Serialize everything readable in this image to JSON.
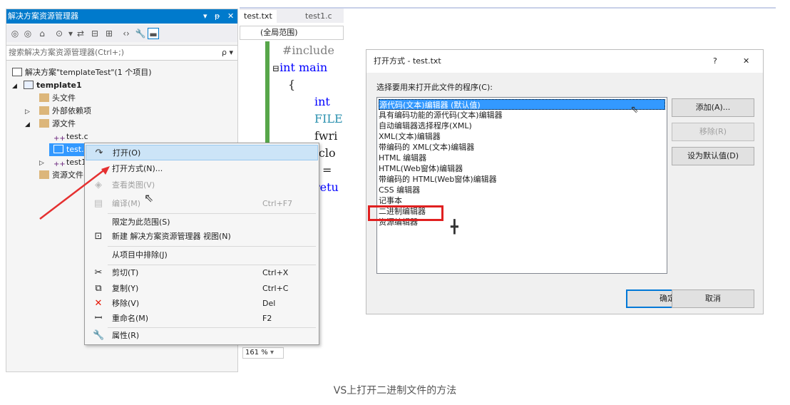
{
  "solution_explorer": {
    "title": "解决方案资源管理器",
    "title_buttons": [
      "▾",
      "ᵽ",
      "✕"
    ],
    "search_placeholder": "搜索解决方案资源管理器(Ctrl+;)",
    "search_icon": "ρ ▾",
    "tree": [
      {
        "label": "解决方案\"templateTest\"(1 个项目)",
        "expander": "",
        "icon": "solution-icon"
      },
      {
        "label": "template1",
        "expander": "◢",
        "icon": "project-icon"
      },
      {
        "label": "头文件",
        "expander": "",
        "icon": "folder-icon"
      },
      {
        "label": "外部依赖项",
        "expander": "▷",
        "icon": "folder-icon"
      },
      {
        "label": "源文件",
        "expander": "◢",
        "icon": "folder-icon"
      },
      {
        "label": "test.c",
        "expander": "",
        "icon": "cpp-file-icon"
      },
      {
        "label": "test.t",
        "expander": "",
        "icon": "text-file-icon"
      },
      {
        "label": "test1",
        "expander": "▷",
        "icon": "cpp-file-icon"
      },
      {
        "label": "资源文件",
        "expander": "",
        "icon": "folder-icon"
      }
    ]
  },
  "context_menu": {
    "items": [
      {
        "label": "打开(O)",
        "shortcut": "",
        "icon": "↷",
        "disabled": false
      },
      {
        "label": "打开方式(N)...",
        "shortcut": "",
        "icon": "",
        "disabled": false
      },
      {
        "label": "查看类图(V)",
        "shortcut": "",
        "icon": "",
        "disabled": true
      },
      {
        "label": "编译(M)",
        "shortcut": "Ctrl+F7",
        "icon": "",
        "disabled": true
      },
      {
        "label": "限定为此范围(S)",
        "shortcut": "",
        "icon": "",
        "disabled": false
      },
      {
        "label": "新建 解决方案资源管理器 视图(N)",
        "shortcut": "",
        "icon": "⊡",
        "disabled": false
      },
      {
        "label": "从项目中排除(J)",
        "shortcut": "",
        "icon": "",
        "disabled": false
      },
      {
        "label": "剪切(T)",
        "shortcut": "Ctrl+X",
        "icon": "✂",
        "disabled": false
      },
      {
        "label": "复制(Y)",
        "shortcut": "Ctrl+C",
        "icon": "⧉",
        "disabled": false
      },
      {
        "label": "移除(V)",
        "shortcut": "Del",
        "icon": "✕",
        "disabled": false
      },
      {
        "label": "重命名(M)",
        "shortcut": "F2",
        "icon": "ꟷ",
        "disabled": false
      },
      {
        "label": "属性(R)",
        "shortcut": "",
        "icon": "🔧",
        "disabled": false
      }
    ]
  },
  "editor": {
    "tabs": [
      "test.txt",
      "test1.c"
    ],
    "scope": "(全局范围)",
    "code_lines": [
      "#include",
      "int main",
      "{",
      "int",
      "FILE",
      "fwri",
      "fclo",
      "f =",
      "retu"
    ],
    "zoom": "161 %"
  },
  "dialog": {
    "title": "打开方式 - test.txt",
    "help": "?",
    "close": "✕",
    "prompt": "选择要用来打开此文件的程序(C):",
    "programs": [
      "源代码(文本)编辑器 (默认值)",
      "具有编码功能的源代码(文本)编辑器",
      "自动编辑器选择程序(XML)",
      "XML(文本)编辑器",
      "带编码的 XML(文本)编辑器",
      "HTML 编辑器",
      "HTML(Web窗体)编辑器",
      "带编码的 HTML(Web窗体)编辑器",
      "CSS 编辑器",
      "记事本",
      "二进制编辑器",
      "资源编辑器"
    ],
    "add_button": "添加(A)...",
    "remove_button": "移除(R)",
    "set_default_button": "设为默认值(D)",
    "ok_button": "确定",
    "cancel_button": "取消"
  },
  "caption": "VS上打开二进制文件的方法",
  "colors": {
    "accent": "#007acc",
    "highlight": "#e02020",
    "selection": "#3399ff"
  }
}
